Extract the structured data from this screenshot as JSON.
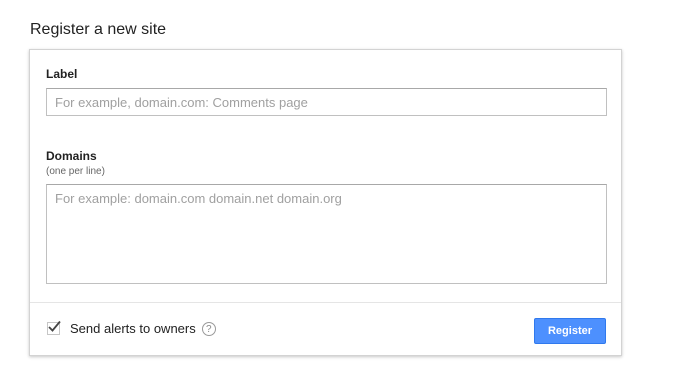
{
  "page": {
    "title": "Register a new site"
  },
  "form": {
    "label_field": {
      "label": "Label",
      "placeholder": "For example, domain.com: Comments page",
      "value": ""
    },
    "domains_field": {
      "label": "Domains",
      "sublabel": "(one per line)",
      "placeholder": "For example: domain.com domain.net domain.org",
      "value": ""
    },
    "alerts_checkbox": {
      "label": "Send alerts to owners",
      "checked": true
    },
    "help_icon": {
      "glyph": "?",
      "name": "help-icon"
    },
    "register_button": {
      "label": "Register"
    }
  },
  "colors": {
    "accent": "#4d90fe",
    "accent_border": "#3079ed"
  }
}
